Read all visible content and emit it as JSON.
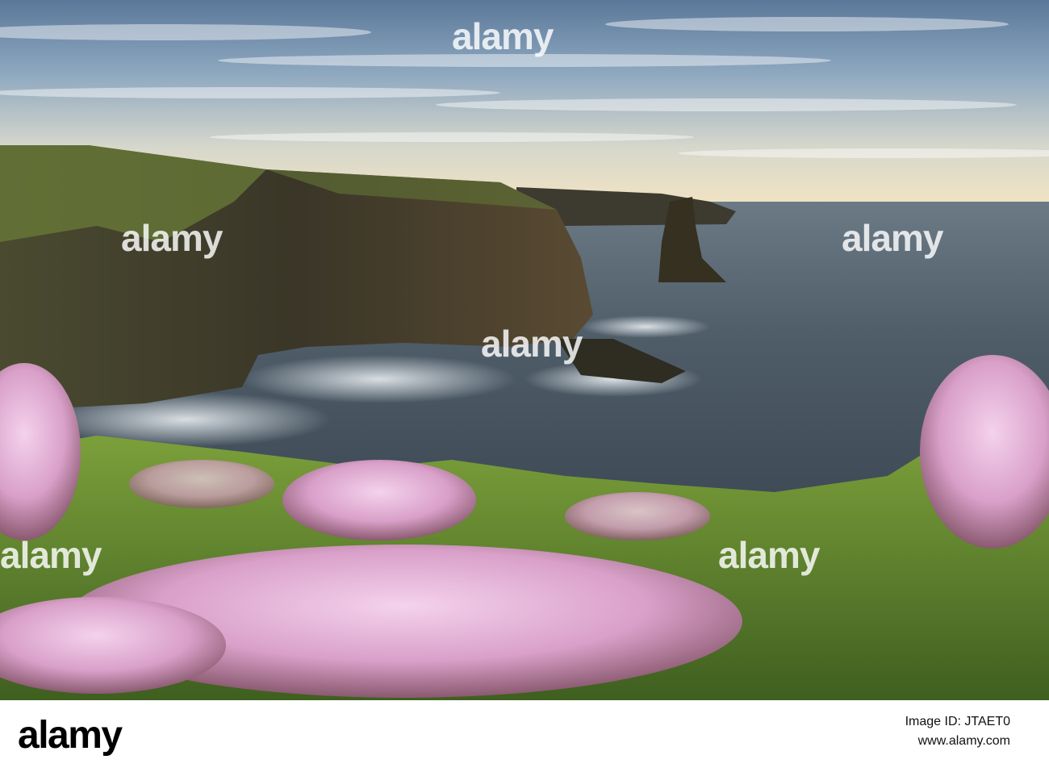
{
  "image": {
    "subject": "coastal-cliffs-sea-stack-thrift-flowers"
  },
  "watermark": {
    "text": "alamy"
  },
  "footer": {
    "logo": "alamy",
    "image_id": "Image ID: JTAET0",
    "website": "www.alamy.com"
  },
  "colors": {
    "sky_top": "#5d7c9c",
    "sky_horizon": "#f1e6c7",
    "sea": "#47545f",
    "cliff": "#3e3b30",
    "grass": "#6d8f33",
    "thrift_pink": "#e8b9dc"
  }
}
